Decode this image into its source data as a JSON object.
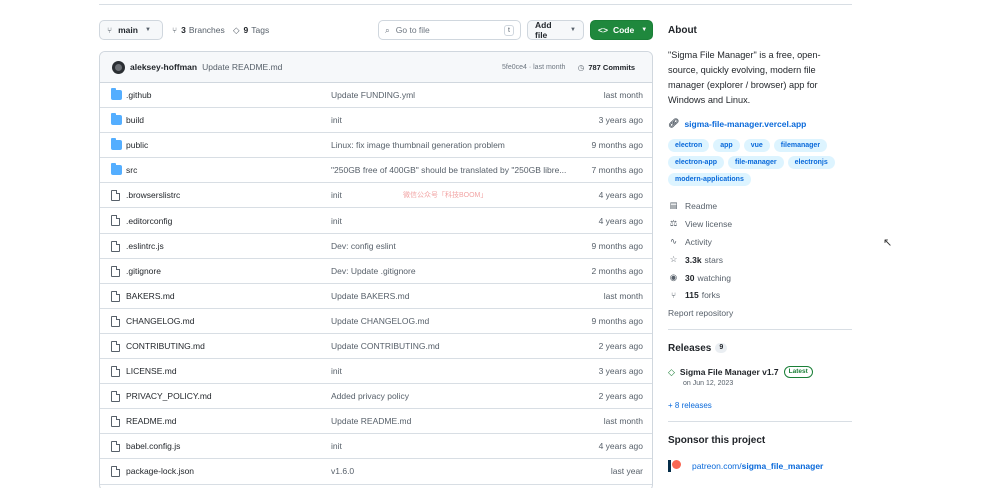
{
  "toolbar": {
    "branch": "main",
    "branches_count": "3",
    "branches_label": "Branches",
    "tags_count": "9",
    "tags_label": "Tags",
    "search_placeholder": "Go to file",
    "search_shortcut": "t",
    "add_file": "Add file",
    "code": "Code"
  },
  "latest_commit": {
    "author": "aleksey-hoffman",
    "message": "Update README.md",
    "meta": "5fe0ce4 · last month",
    "commit_count": "787 Commits"
  },
  "files": [
    {
      "name": ".github",
      "type": "folder",
      "message": "Update FUNDING.yml",
      "date": "last month"
    },
    {
      "name": "build",
      "type": "folder",
      "message": "init",
      "date": "3 years ago"
    },
    {
      "name": "public",
      "type": "folder",
      "message": "Linux: fix image thumbnail generation problem",
      "date": "9 months ago"
    },
    {
      "name": "src",
      "type": "folder",
      "message": "\"250GB free of 400GB\" should be translated by \"250GB libre...",
      "date": "7 months ago"
    },
    {
      "name": ".browserslistrc",
      "type": "file",
      "message": "init",
      "date": "4 years ago"
    },
    {
      "name": ".editorconfig",
      "type": "file",
      "message": "init",
      "date": "4 years ago"
    },
    {
      "name": ".eslintrc.js",
      "type": "file",
      "message": "Dev: config eslint",
      "date": "9 months ago"
    },
    {
      "name": ".gitignore",
      "type": "file",
      "message": "Dev: Update .gitignore",
      "date": "2 months ago"
    },
    {
      "name": "BAKERS.md",
      "type": "file",
      "message": "Update BAKERS.md",
      "date": "last month"
    },
    {
      "name": "CHANGELOG.md",
      "type": "file",
      "message": "Update CHANGELOG.md",
      "date": "9 months ago"
    },
    {
      "name": "CONTRIBUTING.md",
      "type": "file",
      "message": "Update CONTRIBUTING.md",
      "date": "2 years ago"
    },
    {
      "name": "LICENSE.md",
      "type": "file",
      "message": "init",
      "date": "3 years ago"
    },
    {
      "name": "PRIVACY_POLICY.md",
      "type": "file",
      "message": "Added privacy policy",
      "date": "2 years ago"
    },
    {
      "name": "README.md",
      "type": "file",
      "message": "Update README.md",
      "date": "last month"
    },
    {
      "name": "babel.config.js",
      "type": "file",
      "message": "init",
      "date": "4 years ago"
    },
    {
      "name": "package-lock.json",
      "type": "file",
      "message": "v1.6.0",
      "date": "last year"
    }
  ],
  "watermark": "微信公众号「科技BOOM」",
  "about": {
    "heading": "About",
    "description": "\"Sigma File Manager\" is a free, open-source, quickly evolving, modern file manager (explorer / browser) app for Windows and Linux.",
    "homepage": "sigma-file-manager.vercel.app",
    "topics": [
      "electron",
      "app",
      "vue",
      "filemanager",
      "electron-app",
      "file-manager",
      "electronjs",
      "modern-applications"
    ],
    "readme": "Readme",
    "license": "View license",
    "activity": "Activity",
    "stars_count": "3.3k",
    "stars_label": "stars",
    "watching_count": "30",
    "watching_label": "watching",
    "forks_count": "115",
    "forks_label": "forks",
    "report": "Report repository"
  },
  "releases": {
    "heading": "Releases",
    "count": "9",
    "latest_name": "Sigma File Manager v1.7",
    "latest_badge": "Latest",
    "latest_date": "on Jun 12, 2023",
    "more": "+ 8 releases"
  },
  "sponsor": {
    "heading": "Sponsor this project",
    "link_prefix": "patreon.com/",
    "link_name": "sigma_file_manager"
  }
}
